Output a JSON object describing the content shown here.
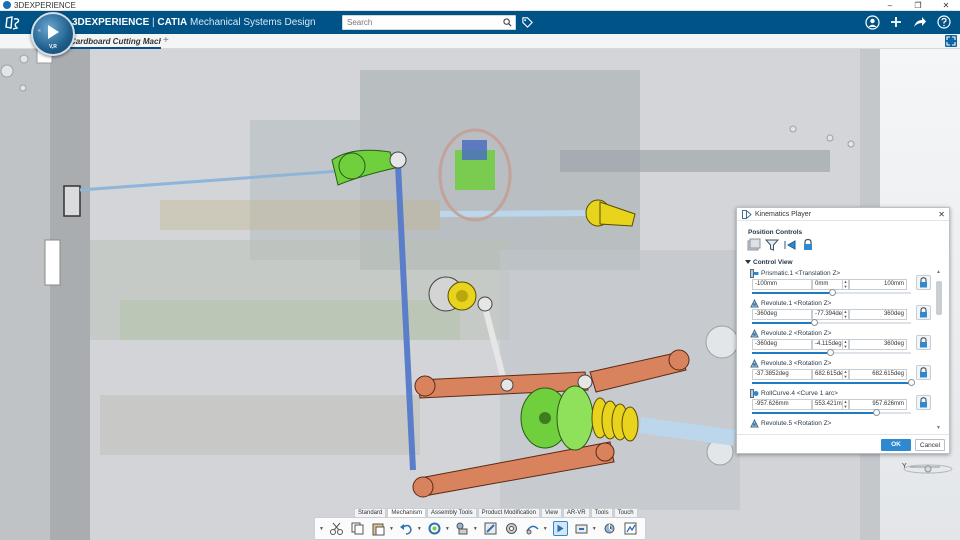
{
  "os": {
    "title": "3DEXPERIENCE",
    "controls": [
      "–",
      "❐",
      "✕"
    ]
  },
  "app": {
    "brand_bold": "3DEXPERIENCE",
    "brand_sep": " | ",
    "brand_app": "CATIA",
    "brand_role": " Mechanical Systems Design",
    "compass_label": "V,R"
  },
  "search": {
    "placeholder": "Search"
  },
  "tab": {
    "label": "Cardboard Cutting Machine",
    "add": "+"
  },
  "kinematics_player": {
    "title": "Kinematics Player",
    "position_controls_label": "Position Controls",
    "control_view_label": "Control View",
    "joints": [
      {
        "name": "Prismatic.1 <Translation Z>",
        "min": "-100mm",
        "current": "0mm",
        "max": "100mm",
        "position": 0.5
      },
      {
        "name": "Revolute.1 <Rotation Z>",
        "min": "-360deg",
        "current": "-77.394deg",
        "max": "360deg",
        "position": 0.39
      },
      {
        "name": "Revolute.2 <Rotation Z>",
        "min": "-360deg",
        "current": "-4.115deg",
        "max": "360deg",
        "position": 0.49
      },
      {
        "name": "Revolute.3 <Rotation Z>",
        "min": "-37.3852deg",
        "current": "682.615deg",
        "max": "682.615deg",
        "position": 1.0
      },
      {
        "name": "RollCurve.4 <Curve 1 arc>",
        "min": "-957.626mm",
        "current": "553.421mm",
        "max": "957.626mm",
        "position": 0.78
      }
    ],
    "last_joint": "Revolute.5 <Rotation Z>",
    "ok_label": "OK",
    "cancel_label": "Cancel"
  },
  "action_bar": {
    "tabs": [
      "Standard",
      "Mechanism",
      "Assembly Tools",
      "Product Modification",
      "View",
      "AR-VR",
      "Tools",
      "Touch"
    ],
    "active_tab": "Mechanism"
  },
  "triad": {
    "label": "Y"
  },
  "colors": {
    "brand": "#005386",
    "ok_button": "#2e89d1",
    "green_part": "#6fcf3c",
    "yellow_part": "#e8d41d",
    "orange_part": "#d9825e",
    "blue_rod": "#5a7ec9"
  }
}
